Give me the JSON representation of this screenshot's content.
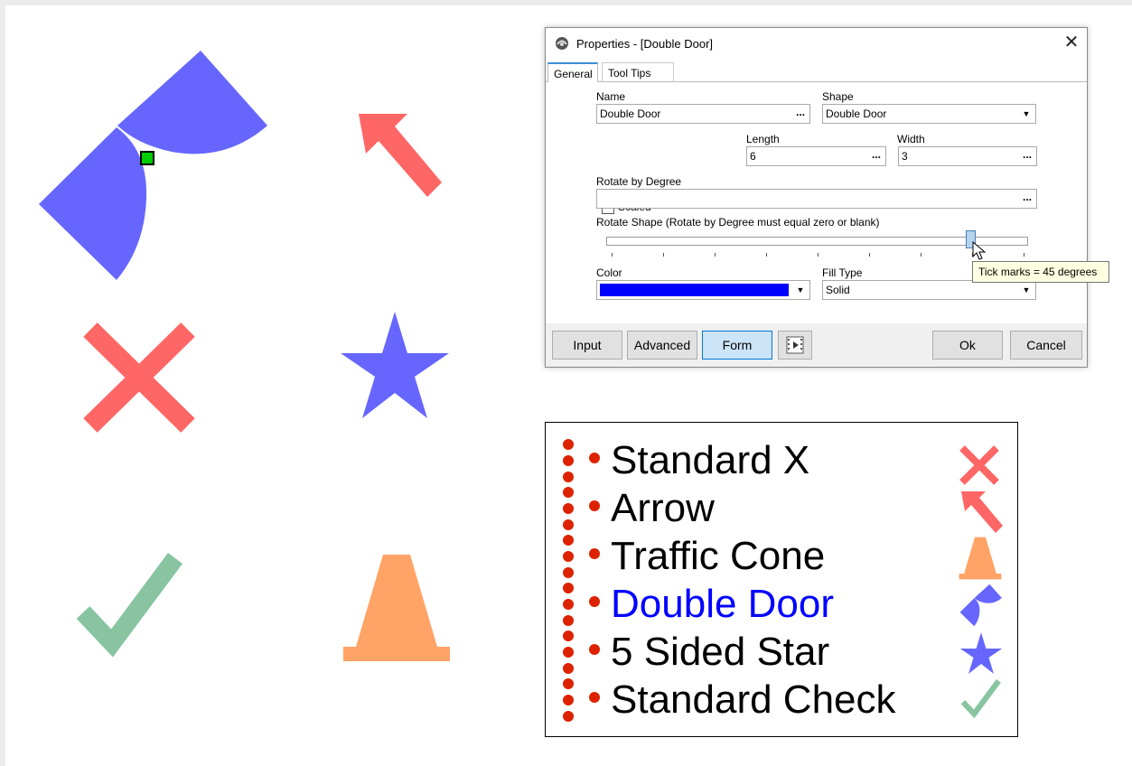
{
  "dialog": {
    "title": "Properties - [Double Door]",
    "close_glyph": "✕",
    "tabs": [
      {
        "label": "General",
        "active": true
      },
      {
        "label": "Tool Tips",
        "active": false
      }
    ],
    "name_label": "Name",
    "name_value": "Double Door",
    "shape_label": "Shape",
    "shape_value": "Double Door",
    "scaled_label": "Scaled",
    "scaled_checked": true,
    "length_label": "Length",
    "length_value": "6",
    "width_label": "Width",
    "width_value": "3",
    "rotate_degree_label": "Rotate by Degree",
    "rotate_degree_value": "",
    "rotate_shape_label": "Rotate Shape (Rotate by Degree must equal zero or blank)",
    "slider_position": 0.875,
    "tooltip": "Tick marks = 45 degrees",
    "color_label": "Color",
    "color_value": "#0000ff",
    "fill_type_label": "Fill Type",
    "fill_type_value": "Solid",
    "ellipsis": "...",
    "buttons": {
      "input": "Input",
      "advanced": "Advanced",
      "form": "Form",
      "ok": "Ok",
      "cancel": "Cancel"
    }
  },
  "legend": {
    "items": [
      {
        "label": "Standard X",
        "color": "#000000",
        "icon": "x-icon"
      },
      {
        "label": "Arrow",
        "color": "#000000",
        "icon": "arrow-icon"
      },
      {
        "label": "Traffic Cone",
        "color": "#000000",
        "icon": "traffic-cone-icon"
      },
      {
        "label": "Double Door",
        "color": "#0000ff",
        "icon": "double-door-icon"
      },
      {
        "label": "5 Sided Star",
        "color": "#000000",
        "icon": "star-icon"
      },
      {
        "label": "Standard Check",
        "color": "#000000",
        "icon": "check-icon"
      }
    ]
  },
  "colors": {
    "x_color": "#ff6666",
    "arrow_color": "#ff6666",
    "door_color": "#6666ff",
    "star_color": "#6666ff",
    "check_color": "#88c4a0",
    "cone_color": "#ffa366",
    "bullet_color": "#dd2200",
    "handle_color": "#00cc00"
  }
}
